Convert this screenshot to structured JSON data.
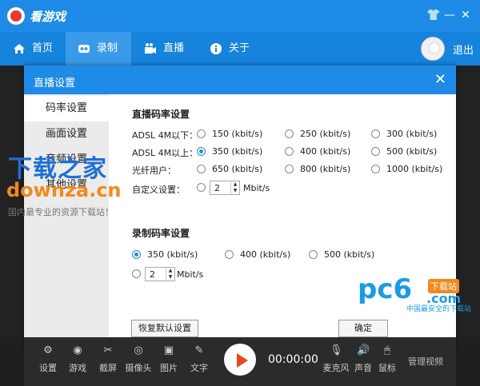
{
  "app": {
    "title": "看游戏"
  },
  "nav": {
    "items": [
      {
        "label": "首页",
        "icon": "home-icon"
      },
      {
        "label": "录制",
        "icon": "record-icon"
      },
      {
        "label": "直播",
        "icon": "live-icon"
      },
      {
        "label": "关于",
        "icon": "info-icon"
      }
    ],
    "active": "录制",
    "logout": "退出"
  },
  "dialog": {
    "title": "直播设置",
    "sidebar": [
      "码率设置",
      "画面设置",
      "音频设置",
      "其他设置"
    ],
    "active_sidebar": "码率设置",
    "live_section": {
      "title": "直播码率设置",
      "rows": [
        {
          "label": "ADSL 4M以下：",
          "options": [
            "150 (kbit/s)",
            "250 (kbit/s)",
            "300  (kbit/s)"
          ]
        },
        {
          "label": "ADSL 4M以上：",
          "options": [
            "350 (kbit/s)",
            "400 (kbit/s)",
            "500  (kbit/s)"
          ]
        },
        {
          "label": "光纤用户：",
          "options": [
            "650 (kbit/s)",
            "800 (kbit/s)",
            "1000 (kbit/s)"
          ]
        }
      ],
      "selected": "350 (kbit/s)",
      "custom_label": "自定义设置：",
      "custom_value": "2",
      "custom_unit": "Mbit/s"
    },
    "record_section": {
      "title": "录制码率设置",
      "options": [
        "350  (kbit/s)",
        "400  (kbit/s)",
        "500  (kbit/s)"
      ],
      "selected": "350  (kbit/s)",
      "custom_value": "2",
      "custom_unit": "Mbit/s"
    },
    "buttons": {
      "restore": "恢复默认设置",
      "ok": "确定"
    }
  },
  "watermarks": {
    "site1_cn": "下载之家",
    "site1_en": "downza.cn",
    "site1_slogan": "国内最专业的资源下载站！",
    "site2_main": "pc6",
    "site2_tag": "下载站",
    "site2_com": ".com",
    "site2_slogan": "中国最安全的下载站"
  },
  "toolbar": {
    "tools": [
      {
        "label": "设置",
        "icon": "gear-icon"
      },
      {
        "label": "游戏",
        "icon": "gamepad-icon"
      },
      {
        "label": "截屏",
        "icon": "scissors-icon"
      },
      {
        "label": "摄像头",
        "icon": "webcam-icon"
      },
      {
        "label": "图片",
        "icon": "image-icon"
      },
      {
        "label": "文字",
        "icon": "text-icon"
      }
    ],
    "timer": "00:00:00",
    "right_tools": [
      {
        "label": "麦克风",
        "icon": "microphone-icon"
      },
      {
        "label": "声音",
        "icon": "speaker-icon"
      },
      {
        "label": "鼠标",
        "icon": "mouse-icon"
      }
    ],
    "manage": "管理视频"
  },
  "colors": {
    "accent": "#1e8be6",
    "record": "#e64a19"
  }
}
